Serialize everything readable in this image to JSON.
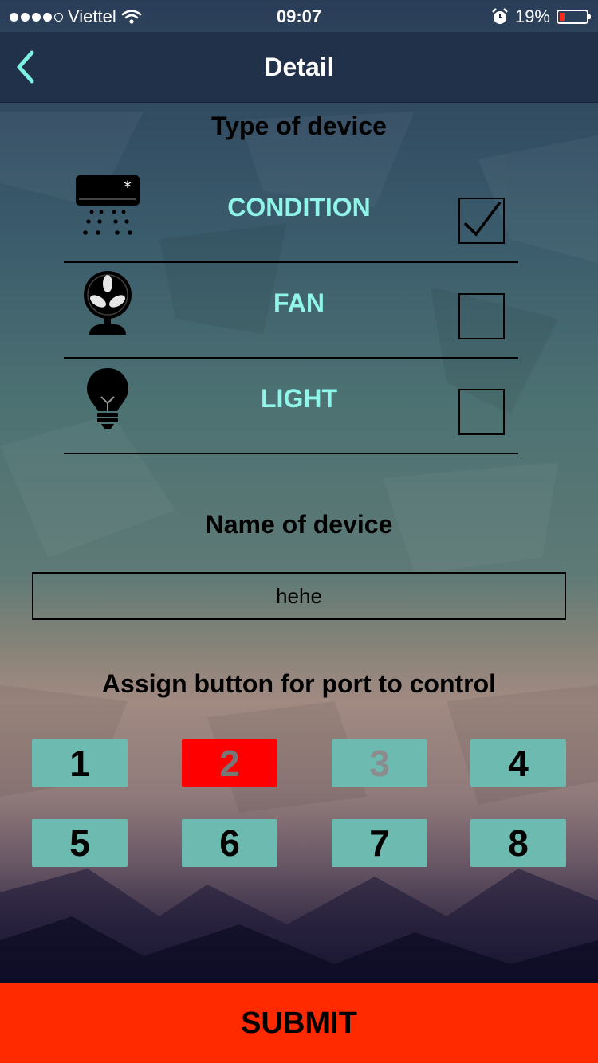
{
  "status": {
    "carrier": "Viettel",
    "time": "09:07",
    "battery": "19%",
    "battery_level": 0.19
  },
  "navbar": {
    "title": "Detail"
  },
  "type_section": {
    "title": "Type of device",
    "options": [
      {
        "label": "CONDITION",
        "icon": "air-conditioner-icon",
        "checked": true
      },
      {
        "label": "FAN",
        "icon": "fan-icon",
        "checked": false
      },
      {
        "label": "LIGHT",
        "icon": "light-bulb-icon",
        "checked": false
      }
    ]
  },
  "name_section": {
    "title": "Name of device",
    "value": "hehe"
  },
  "port_section": {
    "title": "Assign button for port to control",
    "ports": [
      {
        "label": "1",
        "state": "available"
      },
      {
        "label": "2",
        "state": "selected"
      },
      {
        "label": "3",
        "state": "disabled"
      },
      {
        "label": "4",
        "state": "available"
      },
      {
        "label": "5",
        "state": "available"
      },
      {
        "label": "6",
        "state": "available"
      },
      {
        "label": "7",
        "state": "available"
      },
      {
        "label": "8",
        "state": "available"
      }
    ]
  },
  "submit": {
    "label": "SUBMIT"
  },
  "colors": {
    "accent_label": "#8ff5e8",
    "port_bg": "#6cbab0",
    "port_selected": "#ff0000",
    "submit_bg": "#ff2a00",
    "navbar_bg": "#22314a"
  }
}
